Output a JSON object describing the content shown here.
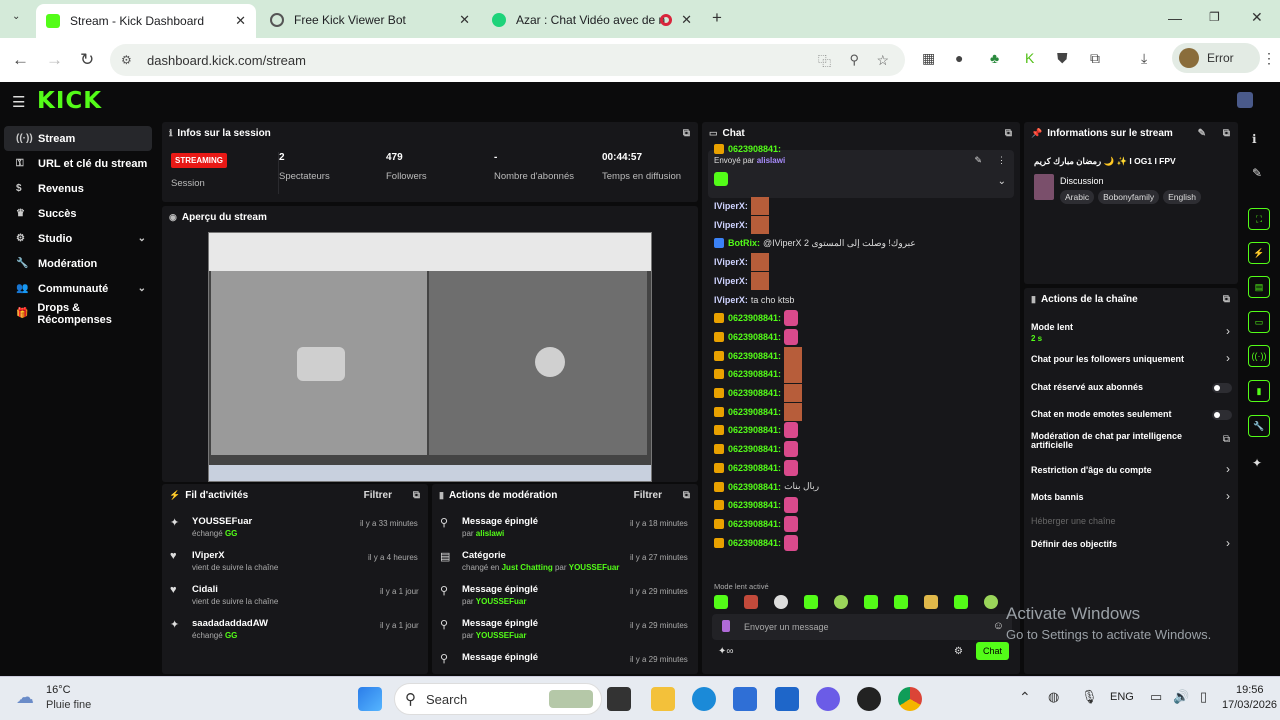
{
  "browser": {
    "tabs": [
      {
        "label": "Stream - Kick Dashboard",
        "active": true
      },
      {
        "label": "Free Kick Viewer Bot",
        "active": false
      },
      {
        "label": "Azar : Chat Vidéo avec de n",
        "active": false
      }
    ],
    "new_tab": "+",
    "url": "dashboard.kick.com/stream",
    "profile_label": "Error"
  },
  "app": {
    "logo": "KICK",
    "sidebar": [
      {
        "label": "Stream",
        "icon": "radio-icon",
        "selected": true
      },
      {
        "label": "URL et clé du stream",
        "icon": "key-icon"
      },
      {
        "label": "Revenus",
        "icon": "money-icon"
      },
      {
        "label": "Succès",
        "icon": "trophy-icon"
      },
      {
        "label": "Studio",
        "icon": "gear-icon",
        "chevron": true
      },
      {
        "label": "Modération",
        "icon": "wrench-icon"
      },
      {
        "label": "Communauté",
        "icon": "users-icon",
        "chevron": true
      },
      {
        "label": "Drops & Récompenses",
        "icon": "gift-icon"
      }
    ],
    "session": {
      "title": "Infos sur la session",
      "status_badge": "STREAMING",
      "status_label": "Session",
      "stats": [
        {
          "value": "2",
          "label": "Spectateurs"
        },
        {
          "value": "479",
          "label": "Followers"
        },
        {
          "value": "-",
          "label": "Nombre d'abonnés"
        },
        {
          "value": "00:44:57",
          "label": "Temps en diffusion"
        }
      ]
    },
    "preview": {
      "title": "Aperçu du stream"
    },
    "activity": {
      "title": "Fil d'activités",
      "filter": "Filtrer",
      "items": [
        {
          "name": "YOUSSEFuar",
          "sub": "échangé",
          "sub_hl": "GG",
          "time": "il y a 33 minutes"
        },
        {
          "name": "IViperX",
          "sub": "vient de suivre la chaîne",
          "sub_hl": "",
          "time": "il y a 4 heures"
        },
        {
          "name": "Cidali",
          "sub": "vient de suivre la chaîne",
          "sub_hl": "",
          "time": "il y a 1 jour"
        },
        {
          "name": "saadadaddadAW",
          "sub": "échangé",
          "sub_hl": "GG",
          "time": "il y a 1 jour"
        }
      ]
    },
    "moderation": {
      "title": "Actions de modération",
      "filter": "Filtrer",
      "items": [
        {
          "name": "Message épinglé",
          "sub": "par",
          "sub_hl": "alislawi",
          "sub_hl2": "",
          "time": "il y a 18 minutes"
        },
        {
          "name": "Catégorie",
          "sub": "changé en",
          "sub_hl": "Just Chatting",
          "sub_hl2": "YOUSSEFuar",
          "time": "il y a 27 minutes"
        },
        {
          "name": "Message épinglé",
          "sub": "par",
          "sub_hl": "YOUSSEFuar",
          "sub_hl2": "",
          "time": "il y a 29 minutes"
        },
        {
          "name": "Message épinglé",
          "sub": "par",
          "sub_hl": "YOUSSEFuar",
          "sub_hl2": "",
          "time": "il y a 29 minutes"
        },
        {
          "name": "Message épinglé",
          "sub": "",
          "sub_hl": "",
          "sub_hl2": "",
          "time": "il y a 29 minutes"
        }
      ]
    },
    "chat": {
      "title": "Chat",
      "pinned_label": "Envoyé par",
      "pinned_user": "alislawi",
      "top_partial": "0623908841:",
      "lines": [
        {
          "name": "IViperX:",
          "kind": "emote-brown"
        },
        {
          "name": "IViperX:",
          "kind": "emote-brown"
        },
        {
          "name": "BotRix:",
          "kind": "text",
          "text": "@IViperX 2 عبروك! وصلت إلى المستوى"
        },
        {
          "name": "IViperX:",
          "kind": "emote-brown"
        },
        {
          "name": "IViperX:",
          "kind": "emote-brown"
        },
        {
          "name": "IViperX:",
          "kind": "text",
          "text": "ta cho ktsb"
        },
        {
          "name": "0623908841:",
          "kind": "emote-pink"
        },
        {
          "name": "0623908841:",
          "kind": "emote-pink"
        },
        {
          "name": "0623908841:",
          "kind": "emote-brown"
        },
        {
          "name": "0623908841:",
          "kind": "emote-brown"
        },
        {
          "name": "0623908841:",
          "kind": "emote-brown"
        },
        {
          "name": "0623908841:",
          "kind": "emote-brown"
        },
        {
          "name": "0623908841:",
          "kind": "emote-pink"
        },
        {
          "name": "0623908841:",
          "kind": "emote-pink"
        },
        {
          "name": "0623908841:",
          "kind": "emote-pink"
        },
        {
          "name": "0623908841:",
          "kind": "text",
          "text": "ربال بنات"
        },
        {
          "name": "0623908841:",
          "kind": "emote-pink"
        },
        {
          "name": "0623908841:",
          "kind": "emote-pink"
        },
        {
          "name": "0623908841:",
          "kind": "emote-pink"
        }
      ],
      "slow_mode": "Mode lent activé",
      "input_placeholder": "Envoyer un message",
      "send_label": "Chat"
    },
    "stream_info": {
      "title": "Informations sur le stream",
      "stream_title": "رمضان مبارك كريم 🌙 ✨ I OG1 I FPV",
      "category": "Discussion",
      "tags": [
        "Arabic",
        "Bobonyfamily",
        "English"
      ]
    },
    "channel_actions": {
      "title": "Actions de la chaîne",
      "items": [
        {
          "label": "Mode lent",
          "sub": "2 s",
          "control": "arrow"
        },
        {
          "label": "Chat pour les followers uniquement",
          "control": "arrow"
        },
        {
          "label": "Chat réservé aux abonnés",
          "control": "toggle"
        },
        {
          "label": "Chat en mode emotes seulement",
          "control": "toggle"
        },
        {
          "label": "Modération de chat par intelligence artificielle",
          "control": "external"
        },
        {
          "label": "Restriction d'âge du compte",
          "control": "arrow"
        },
        {
          "label": "Mots bannis",
          "control": "arrow"
        },
        {
          "label": "Héberger une chaîne",
          "control": "none",
          "disabled": true
        },
        {
          "label": "Définir des objectifs",
          "control": "arrow"
        }
      ]
    }
  },
  "taskbar": {
    "weather_temp": "16°C",
    "weather_desc": "Pluie fine",
    "search": "Search",
    "lang": "ENG",
    "time": "19:56",
    "date": "17/03/2026"
  },
  "watermark": {
    "line1": "Activate Windows",
    "line2": "Go to Settings to activate Windows."
  },
  "colors": {
    "accent": "#53fc18",
    "live": "#e91916",
    "panel": "#17171a"
  }
}
